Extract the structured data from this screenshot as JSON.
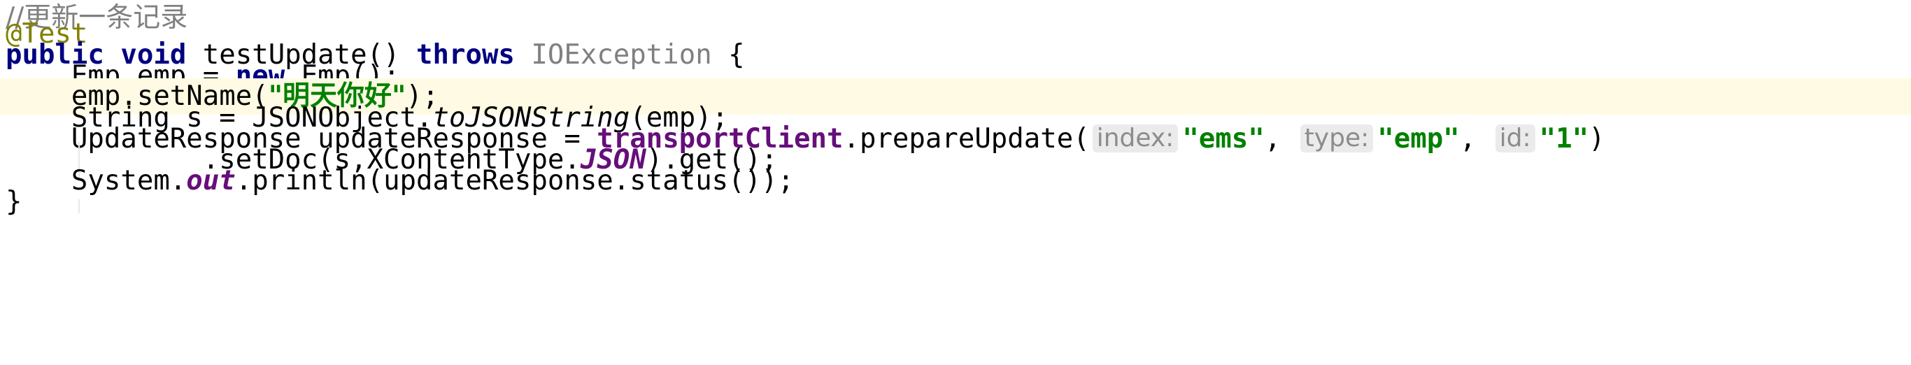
{
  "code": {
    "comment": "//更新一条记录",
    "annotation": "@Test",
    "method_signature": {
      "kw_public": "public",
      "kw_void": "void",
      "name": "testUpdate()",
      "kw_throws": "throws",
      "exception": "IOException",
      "brace_open": "{"
    },
    "line_emp_new": {
      "decl": "Emp emp = ",
      "kw_new": "new",
      "rest": " Emp();"
    },
    "line_set_name": {
      "call": "emp.setName(",
      "string": "\"明天你好\"",
      "end": ");"
    },
    "line_json": {
      "decl": "String s = JSONObject.",
      "static_call": "toJSONString",
      "end": "(emp);"
    },
    "line_update": {
      "decl": "UpdateResponse updateResponse = ",
      "field": "transportClient",
      "call": ".prepareUpdate(",
      "hint_index": "index:",
      "arg_index": "\"ems\"",
      "sep1": ",",
      "hint_type": "type:",
      "arg_type": "\"emp\"",
      "sep2": ",",
      "hint_id": "id:",
      "arg_id": "\"1\"",
      "end": ")"
    },
    "line_setdoc": {
      "call": ".setDoc(s,XContentType.",
      "static_field": "JSON",
      "end": ").get();"
    },
    "line_println": {
      "start": "System.",
      "static_field": "out",
      "end": ".println(updateResponse.status());"
    },
    "brace_close": "}"
  },
  "colors": {
    "keyword": "#000080",
    "string": "#008000",
    "comment": "#808080",
    "annotation": "#808000",
    "field": "#660e7a",
    "current_line": "#fffae3",
    "hint_bg": "#ebebeb"
  }
}
